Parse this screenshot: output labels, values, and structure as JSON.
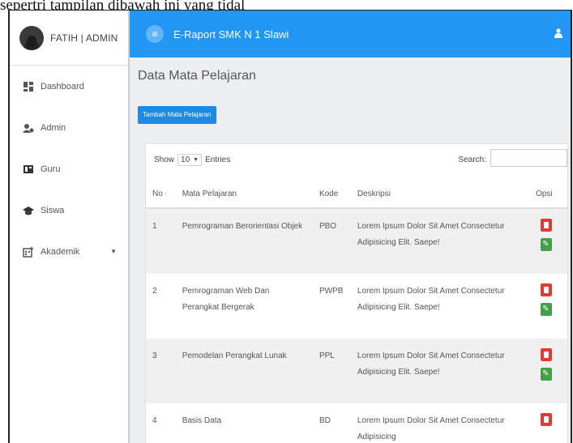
{
  "caption": "sepertri tampilan dibawah ini yang tidal",
  "sidebar": {
    "user_name": "FATIH | ADMIN",
    "items": [
      {
        "label": "Dashboard",
        "icon": "dashboard-icon"
      },
      {
        "label": "Admin",
        "icon": "admin-icon"
      },
      {
        "label": "Guru",
        "icon": "guru-icon"
      },
      {
        "label": "Siswa",
        "icon": "siswa-icon"
      },
      {
        "label": "Akademik",
        "icon": "akademik-icon",
        "has_caret": true
      }
    ]
  },
  "topbar": {
    "title": "E-Raport SMK N 1 Slawi",
    "color": "#2196f3"
  },
  "page": {
    "title": "Data Mata Pelajaran",
    "add_button": "Tambah Mata Pelajaran"
  },
  "table_controls": {
    "show_label": "Show",
    "entries_value": "10",
    "entries_label": "Entries",
    "search_label": "Search:"
  },
  "table": {
    "headers": [
      "No",
      "Mata Pelajaran",
      "Kode",
      "Deskripsi",
      "Opsi"
    ],
    "rows": [
      {
        "no": "1",
        "mapel": "Pemrograman Berorientasi Objek",
        "kode": "PBO",
        "deskripsi": "Lorem Ipsum Dolor Sit Amet Consectetur Adipisicing Elit. Saepe!"
      },
      {
        "no": "2",
        "mapel": "Pemrograman Web Dan Perangkat Bergerak",
        "kode": "PWPB",
        "deskripsi": "Lorem Ipsum Dolor Sit Amet Consectetur Adipisicing Elit. Saepe!"
      },
      {
        "no": "3",
        "mapel": "Pemodelan Perangkat Lunak",
        "kode": "PPL",
        "deskripsi": "Lorem Ipsum Dolor Sit Amet Consectetur Adipisicing Elit. Saepe!"
      },
      {
        "no": "4",
        "mapel": "Basis Data",
        "kode": "BD",
        "deskripsi": "Lorem Ipsum Dolor Sit Amet Consectetur Adipisicing"
      }
    ]
  }
}
